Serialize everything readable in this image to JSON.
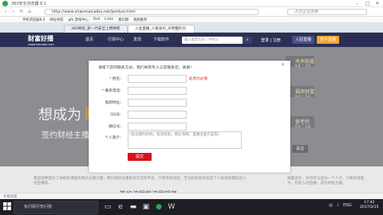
{
  "browser": {
    "title": "360安全浏览器 8.1",
    "url": "http://www.shaomaicaibo.net/jonduo.html",
    "search_placeholder": "点击这里搜索",
    "bookmarks": [
      "手机浏览器8.0",
      "网址导航",
      "gfk 游戏中心",
      "Dell",
      "Links",
      "看幻图",
      "视频推荐"
    ],
    "tabs": [
      "360导航_新一代安全上网导航",
      "入驻直播_人能身价_声明面的力"
    ],
    "status_left": "今日优选"
  },
  "site": {
    "logo_text": "财富好播",
    "logo_sub": "shaomaicaibo.com",
    "nav": [
      "首页",
      "行情中心",
      "发现",
      "下载软件"
    ],
    "search_placeholder": "输入股票代码 / 手机号",
    "login": "登录 | 注册",
    "join_btn": "入驻直播",
    "open_btn": "开户直播",
    "hero_big": "想成为",
    "hero_accent": "财经",
    "hero_line2": "签约财经主播",
    "right_items": [
      {
        "name": "木木船盘",
        "sub": "6.8 ♡ 5.6"
      },
      {
        "name": "福周财富",
        "sub": "6.4 ♡ 5.2"
      },
      {
        "name": "萝老师",
        "sub": "6.0 ♡ 4.8"
      }
    ],
    "follow_btn": "关注",
    "lower_left": "我是财神面为了扶植有潜能优秀的主播力量，我们提供主播投资交流的平台，只有你有经验，无论机构高手还是个人投资者都欢迎入驻直播间。",
    "lower_right": "跟着高手，你也可以成为一个人才，只要你有能力，欢迎入驻直播，成为财经主播。",
    "bottom_title": "签约流程和流程规范"
  },
  "modal": {
    "header": "请留下您的联系方式，我们将有专人与您联系您，谢谢！",
    "close": "✕",
    "fields": [
      {
        "label": "* 姓名：",
        "value": ""
      },
      {
        "label": "* 联系电话：",
        "value": ""
      },
      {
        "label": "电邮地址：",
        "value": ""
      },
      {
        "label": "QQ号：",
        "value": ""
      },
      {
        "label": "微信号：",
        "value": ""
      }
    ],
    "required_note": "此项为必填",
    "intro_label": "个人简介：",
    "intro_placeholder": "(您过职的机构，投资经验，擅长领域，直播主题方案等)",
    "submit_label": "提交"
  },
  "taskbar": {
    "search_placeholder": "有问题尽管问我",
    "time": "17:42",
    "date": "2017/2/15",
    "ime": "中",
    "lang": "ENG"
  },
  "colors": {
    "accent_red": "#d5121d",
    "nav_dark": "#2b2f55",
    "brand_gold": "#f0a830"
  }
}
